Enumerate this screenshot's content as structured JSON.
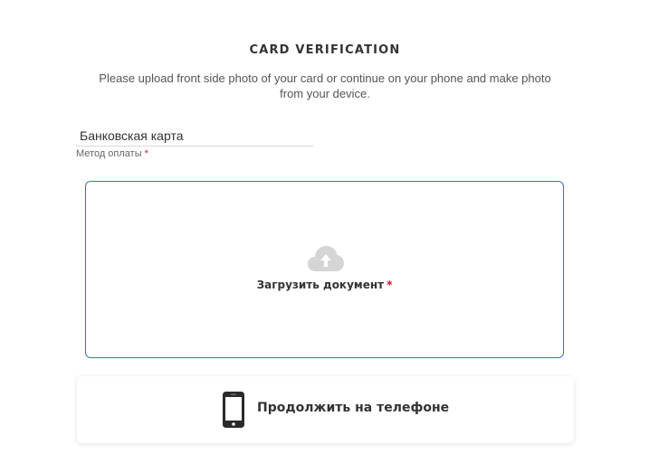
{
  "header": {
    "title": "CARD VERIFICATION",
    "subtitle": "Please upload front side photo of your card or continue on your phone and make photo from your device."
  },
  "payment_method": {
    "value": "Банковская карта",
    "label": "Метод оплаты",
    "required_mark": "*"
  },
  "upload": {
    "icon": "cloud-upload-icon",
    "label": "Загрузить документ",
    "required_mark": "*"
  },
  "phone_option": {
    "icon": "smartphone-icon",
    "label": "Продолжить на телефоне"
  },
  "colors": {
    "accent_border": "#3b6fd1",
    "required": "#d0102a",
    "icon_gray": "#d5d5d5",
    "text_dark": "#333333"
  }
}
